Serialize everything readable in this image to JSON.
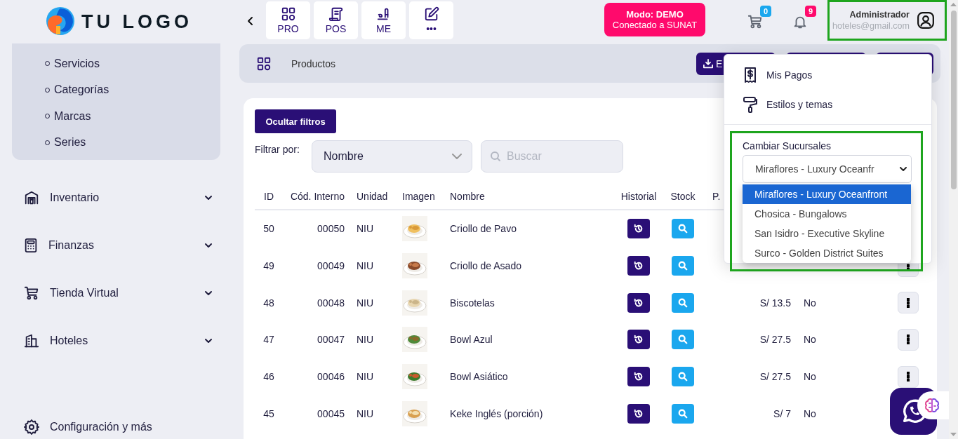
{
  "header": {
    "logo_text": "TU LOGO",
    "modules": [
      {
        "label": "PRO",
        "kind": "grid"
      },
      {
        "label": "POS",
        "kind": "scroll"
      },
      {
        "label": "ME",
        "kind": "sign"
      },
      {
        "label": "•••",
        "kind": "edit"
      }
    ],
    "demo_badge": {
      "title": "Modo: DEMO",
      "subtitle": "Conectado a SUNAT"
    },
    "cart": {
      "count": "0"
    },
    "notifications": {
      "count": "9"
    },
    "user": {
      "name": "Administrador",
      "email": "hoteles@gmail.com"
    }
  },
  "sidebar": {
    "submenu": [
      "Servicios",
      "Categorías",
      "Marcas",
      "Series"
    ],
    "items": [
      {
        "label": "Inventario",
        "kind": "warehouse"
      },
      {
        "label": "Finanzas",
        "kind": "calculator"
      },
      {
        "label": "Tienda Virtual",
        "kind": "cart"
      },
      {
        "label": "Hoteles",
        "kind": "building"
      }
    ],
    "footer": {
      "label": "Configuración y más"
    }
  },
  "breadcrumb": {
    "title": "Productos",
    "actions": [
      {
        "label": "E",
        "kind": "export"
      },
      {
        "kind": "plain"
      },
      {
        "kind": "plain"
      }
    ]
  },
  "filters": {
    "toggle_label": "Ocultar filtros",
    "filter_label": "Filtrar por:",
    "field": "Nombre",
    "search": {
      "placeholder": "Buscar"
    }
  },
  "table": {
    "columns": [
      "ID",
      "Cód. Interno",
      "Unidad",
      "Imagen",
      "Nombre",
      "Historial",
      "Stock",
      "P."
    ],
    "rows": [
      {
        "id": "50",
        "code": "00050",
        "unit": "NIU",
        "name": "Criollo de Pavo",
        "menu_button": false
      },
      {
        "id": "49",
        "code": "00049",
        "unit": "NIU",
        "name": "Criollo de Asado",
        "menu_button": true
      },
      {
        "id": "48",
        "code": "00048",
        "unit": "NIU",
        "name": "Biscotelas",
        "price": "S/ 13.5",
        "column_9": "No",
        "menu_button": true
      },
      {
        "id": "47",
        "code": "00047",
        "unit": "NIU",
        "name": "Bowl Azul",
        "price": "S/ 27.5",
        "column_9": "No",
        "menu_button": true
      },
      {
        "id": "46",
        "code": "00046",
        "unit": "NIU",
        "name": "Bowl Asiático",
        "price": "S/ 27.5",
        "column_9": "No",
        "menu_button": true
      },
      {
        "id": "45",
        "code": "00045",
        "unit": "NIU",
        "name": "Keke Inglés (porción)",
        "price": "S/ 7",
        "column_9": "No",
        "menu_button": false
      }
    ]
  },
  "user_menu": {
    "items": [
      {
        "label": "Mis Pagos",
        "kind": "receipt"
      },
      {
        "label": "Estilos y temas",
        "kind": "roller"
      }
    ],
    "branch_label": "Cambiar Sucursales",
    "branch_value": "Miraflores - Luxury Oceanfr",
    "branch_options": [
      {
        "label": "Miraflores - Luxury Oceanfront",
        "selected": true
      },
      {
        "label": "Chosica - Bungalows",
        "selected": false
      },
      {
        "label": "San Isidro - Executive Skyline",
        "selected": false
      },
      {
        "label": "Surco - Golden District Suites",
        "selected": false
      }
    ]
  }
}
